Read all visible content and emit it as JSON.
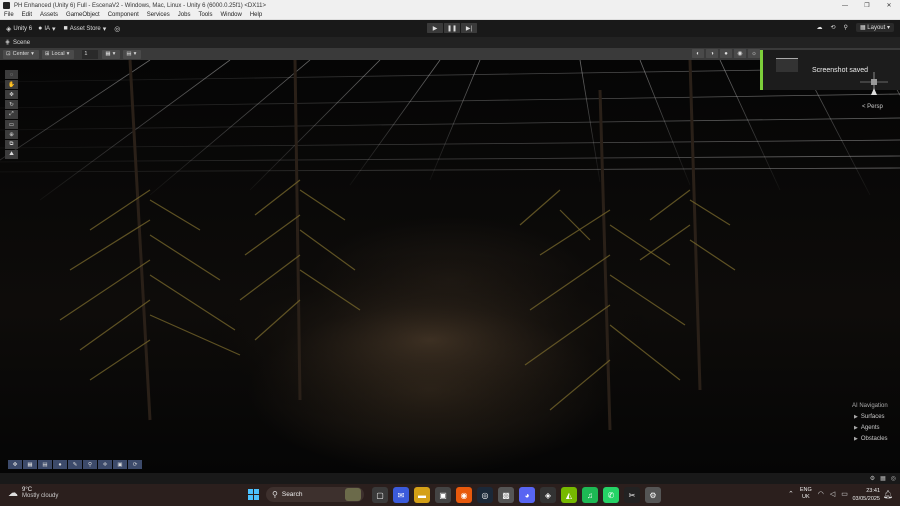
{
  "window": {
    "title": "PH Enhanced (Unity 6) Full - EscenaV2 - Windows, Mac, Linux - Unity 6 (6000.0.25f1) <DX11>",
    "controls": [
      "—",
      "❐",
      "✕"
    ]
  },
  "menu": [
    "File",
    "Edit",
    "Assets",
    "GameObject",
    "Component",
    "Services",
    "Jobs",
    "Tools",
    "Window",
    "Help"
  ],
  "toolbar": {
    "account_label": "Unity 6",
    "ia_label": "IA",
    "asset_store_label": "Asset Store",
    "layout_label": "Layout"
  },
  "scene_tab": {
    "label": "Scene"
  },
  "scene_toolbar": {
    "pivot_label": "Center",
    "space_label": "Local",
    "grid_snap_value": "1"
  },
  "notification": {
    "message": "Screenshot saved"
  },
  "view": {
    "projection_label": "< Persp"
  },
  "ai_navigation": {
    "header": "AI Navigation",
    "items": [
      "Surfaces",
      "Agents",
      "Obstacles"
    ]
  },
  "taskbar": {
    "weather_temp": "9°C",
    "weather_desc": "Mostly cloudy",
    "search_label": "Search",
    "lang_primary": "ENG",
    "lang_secondary": "UK",
    "time": "23:41",
    "date": "03/05/2025"
  },
  "colors": {
    "notification_accent": "#7cce3a",
    "start_blue": "#4cc2ff",
    "active_tool": "#2d5f8a"
  }
}
